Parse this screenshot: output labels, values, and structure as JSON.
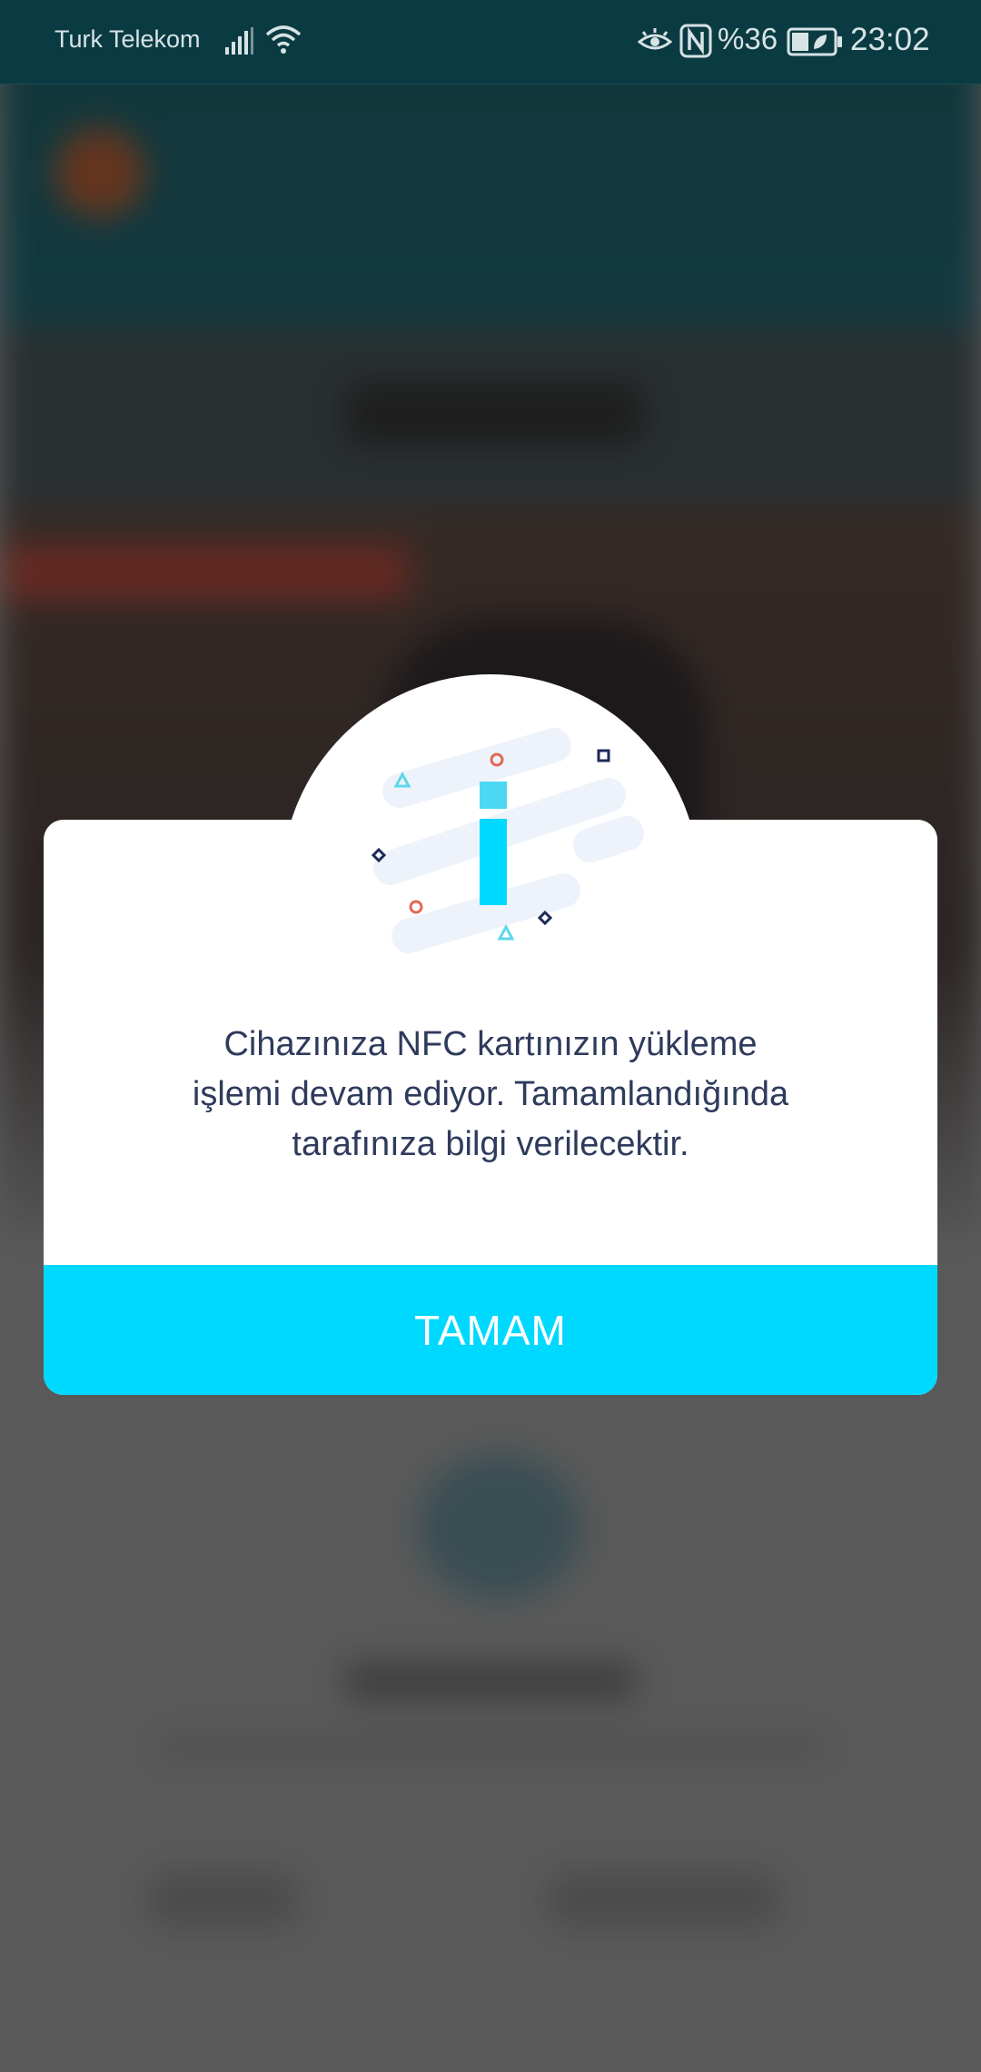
{
  "status_bar": {
    "carrier": "Turk Telekom",
    "battery_percent": "%36",
    "time": "23:02",
    "icons": [
      "signal-icon",
      "wifi-icon",
      "eye-comfort-icon",
      "nfc-icon",
      "battery-icon"
    ]
  },
  "dialog": {
    "icon": "info-icon",
    "message_lines": [
      "Cihazınıza NFC kartınızın yükleme",
      "işlemi devam ediyor. Tamamlandığında",
      "tarafınıza bilgi verilecektir."
    ],
    "button_label": "TAMAM",
    "colors": {
      "accent": "#00d9ff",
      "text": "#2f3b5c",
      "confetti_red": "#e06a55",
      "confetti_blue": "#5ed8e8",
      "confetti_navy": "#1e2a57"
    }
  }
}
